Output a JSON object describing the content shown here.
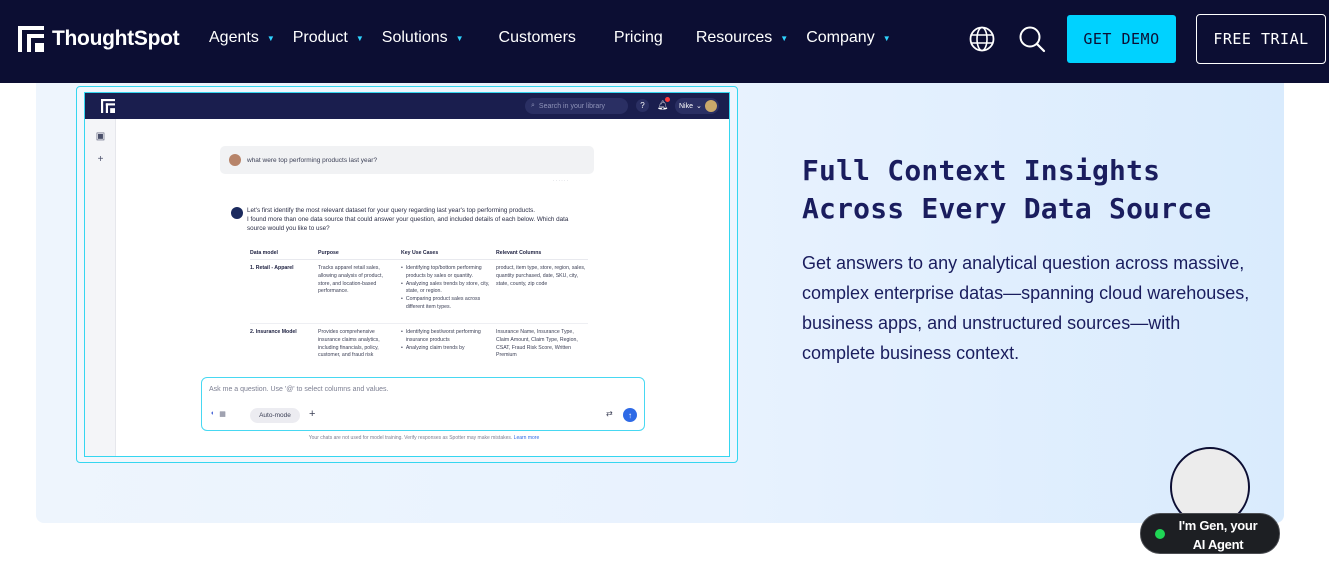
{
  "nav": {
    "brand": "ThoughtSpot",
    "items": [
      {
        "label": "Agents",
        "has_menu": true
      },
      {
        "label": "Product",
        "has_menu": true
      },
      {
        "label": "Solutions",
        "has_menu": true
      },
      {
        "label": "Customers",
        "has_menu": false
      },
      {
        "label": "Pricing",
        "has_menu": false
      },
      {
        "label": "Resources",
        "has_menu": true
      },
      {
        "label": "Company",
        "has_menu": true
      }
    ],
    "icons": [
      "globe-icon",
      "search-icon"
    ],
    "get_demo": "GET DEMO",
    "free_trial": "FREE TRIAL"
  },
  "colors": {
    "nav_bg": "#0c0e33",
    "accent": "#00d2ff",
    "heading": "#1a1d5e"
  },
  "preview": {
    "search_placeholder": "Search in your library",
    "user_name": "Nike",
    "question": "what were top performing products last year?",
    "answer_line1": "Let's first identify the most relevant dataset for your query regarding last year's top performing products.",
    "answer_line2": "I found more than one data source that could answer your question, and included details of each below. Which data source would you like to use?",
    "table": {
      "headers": [
        "Data model",
        "Purpose",
        "Key Use Cases",
        "Relevant Columns"
      ],
      "rows": [
        {
          "model": "1. Retail - Apparel",
          "purpose": "Tracks apparel retail sales, allowing analysis of product, store, and location-based performance.",
          "uses": [
            "Identifying top/bottom performing products by sales or quantity.",
            "Analyzing sales trends by store, city, state, or region.",
            "Comparing product sales across different item types."
          ],
          "columns": "product, item type, store, region, sales, quantity purchased, date, SKU, city, state, county, zip code"
        },
        {
          "model": "2. Insurance Model",
          "purpose": "Provides comprehensive insurance claims analytics, including financials, policy, customer, and fraud risk",
          "uses": [
            "Identifying best/worst performing insurance products",
            "Analyzing claim trends by"
          ],
          "columns": "Insurance Name, Insurance Type, Claim Amount, Claim Type, Region, CSAT, Fraud Risk Score, Written Premium"
        }
      ]
    },
    "input_placeholder": "Ask me a question. Use '@' to select columns and values.",
    "auto_mode": "Auto-mode",
    "disclaimer": "Your chats are not used for model training. Verify responses as Spotter may make mistakes.",
    "learn_more": "Learn more"
  },
  "feature": {
    "title_line1": "Full Context Insights",
    "title_line2": "Across Every Data Source",
    "body": "Get answers to any analytical question across massive, complex enterprise datas—spanning cloud warehouses, business apps, and unstructured sources—with complete business context."
  },
  "agent": {
    "line1": "I'm Gen, your",
    "line2": "AI Agent"
  }
}
